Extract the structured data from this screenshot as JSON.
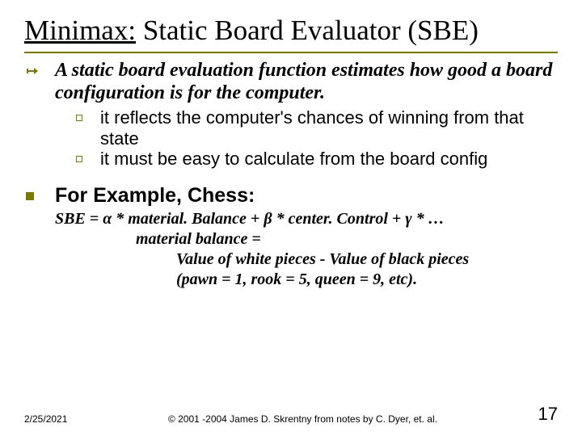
{
  "title_underlined": "Minimax:",
  "title_rest": " Static Board Evaluator (SBE)",
  "point1": "A static board evaluation function estimates how good a board configuration is for the computer.",
  "sub1": "it reflects the computer's chances of winning from that state",
  "sub2": "it must be easy to calculate from the board config",
  "point2": "For Example, Chess:",
  "formula_line1": "SBE = α * material. Balance + β * center. Control + γ * …",
  "formula_line2": "material balance =",
  "formula_line3": "Value of white pieces - Value of black pieces",
  "formula_line4": "(pawn = 1, rook = 5, queen = 9, etc).",
  "footer_date": "2/25/2021",
  "footer_copyright": "© 2001 -2004 James D. Skrentny from notes by C. Dyer, et. al.",
  "footer_page": "17"
}
